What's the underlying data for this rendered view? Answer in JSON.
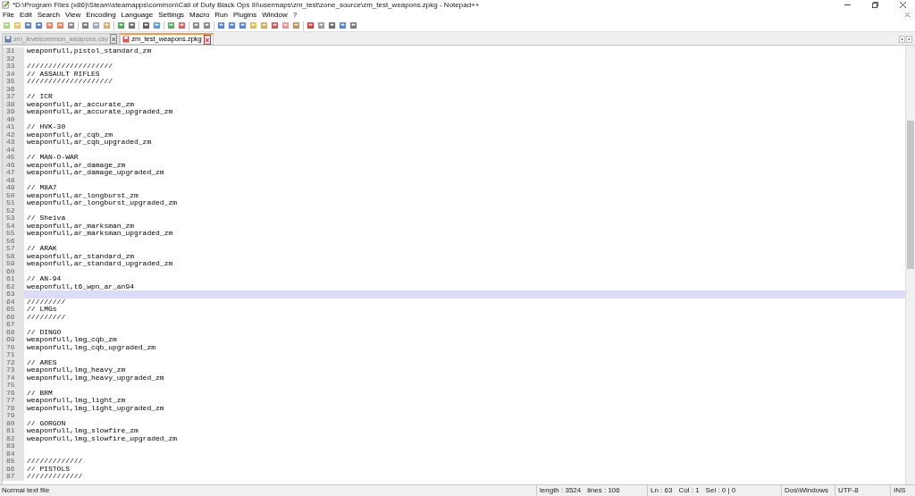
{
  "window": {
    "title": "*D:\\Program Files (x86)\\Steam\\steamapps\\common\\Call of Duty Black Ops III\\usermaps\\zm_test\\zone_source\\zm_test_weapons.zpkg - Notepad++"
  },
  "menu": [
    "File",
    "Edit",
    "Search",
    "View",
    "Encoding",
    "Language",
    "Settings",
    "Macro",
    "Run",
    "Plugins",
    "Window",
    "?"
  ],
  "tabs": [
    {
      "label": "zm_levelcommon_weapons.csv",
      "selected": false,
      "modified": false,
      "close_glyph": "x"
    },
    {
      "label": "zm_test_weapons.zpkg",
      "selected": true,
      "modified": true,
      "close_glyph": "x"
    }
  ],
  "editor": {
    "lines": [
      {
        "number": "31",
        "text": "weaponfull,pistol_standard_zm",
        "selected": false
      },
      {
        "number": "32",
        "selected": false
      },
      {
        "number": "33",
        "text": "////////////////////",
        "selected": false
      },
      {
        "number": "34",
        "text": "// ASSAULT RIFLES",
        "selected": false
      },
      {
        "number": "35",
        "text": "////////////////////",
        "selected": false
      },
      {
        "number": "36",
        "selected": false
      },
      {
        "number": "37",
        "text": "// ICR",
        "selected": false
      },
      {
        "number": "38",
        "text": "weaponfull,ar_accurate_zm",
        "selected": false
      },
      {
        "number": "39",
        "text": "weaponfull,ar_accurate_upgraded_zm",
        "selected": false
      },
      {
        "number": "40",
        "selected": false
      },
      {
        "number": "41",
        "text": "// HVK-30",
        "selected": false
      },
      {
        "number": "42",
        "text": "weaponfull,ar_cqb_zm",
        "selected": false
      },
      {
        "number": "43",
        "text": "weaponfull,ar_cqb_upgraded_zm",
        "selected": false
      },
      {
        "number": "44",
        "selected": false
      },
      {
        "number": "45",
        "text": "// MAN-O-WAR",
        "selected": false
      },
      {
        "number": "46",
        "text": "weaponfull,ar_damage_zm",
        "selected": false
      },
      {
        "number": "47",
        "text": "weaponfull,ar_damage_upgraded_zm",
        "selected": false
      },
      {
        "number": "48",
        "selected": false
      },
      {
        "number": "49",
        "text": "// M8A7",
        "selected": false
      },
      {
        "number": "50",
        "text": "weaponfull,ar_longburst_zm",
        "selected": false
      },
      {
        "number": "51",
        "text": "weaponfull,ar_longburst_upgraded_zm",
        "selected": false
      },
      {
        "number": "52",
        "selected": false
      },
      {
        "number": "53",
        "text": "// Sheiva",
        "selected": false
      },
      {
        "number": "54",
        "text": "weaponfull,ar_marksman_zm",
        "selected": false
      },
      {
        "number": "55",
        "text": "weaponfull,ar_marksman_upgraded_zm",
        "selected": false
      },
      {
        "number": "56",
        "selected": false
      },
      {
        "number": "57",
        "text": "// ARAK",
        "selected": false
      },
      {
        "number": "58",
        "text": "weaponfull,ar_standard_zm",
        "selected": false
      },
      {
        "number": "59",
        "text": "weaponfull,ar_standard_upgraded_zm",
        "selected": false
      },
      {
        "number": "60",
        "selected": false
      },
      {
        "number": "61",
        "text": "// AN-94",
        "selected": false
      },
      {
        "number": "62",
        "text": "weaponfull,t6_wpn_ar_an94",
        "selected": false
      },
      {
        "number": "63",
        "selected": true
      },
      {
        "number": "64",
        "text": "/////////",
        "selected": false
      },
      {
        "number": "65",
        "text": "// LMGs",
        "selected": false
      },
      {
        "number": "66",
        "text": "/////////",
        "selected": false
      },
      {
        "number": "67",
        "selected": false
      },
      {
        "number": "68",
        "text": "// DINGO",
        "selected": false
      },
      {
        "number": "69",
        "text": "weaponfull,lmg_cqb_zm",
        "selected": false
      },
      {
        "number": "70",
        "text": "weaponfull,lmg_cqb_upgraded_zm",
        "selected": false
      },
      {
        "number": "71",
        "selected": false
      },
      {
        "number": "72",
        "text": "// ARES",
        "selected": false
      },
      {
        "number": "73",
        "text": "weaponfull,lmg_heavy_zm",
        "selected": false
      },
      {
        "number": "74",
        "text": "weaponfull,lmg_heavy_upgraded_zm",
        "selected": false
      },
      {
        "number": "75",
        "selected": false
      },
      {
        "number": "76",
        "text": "// BRM",
        "selected": false
      },
      {
        "number": "77",
        "text": "weaponfull,lmg_light_zm",
        "selected": false
      },
      {
        "number": "78",
        "text": "weaponfull,lmg_light_upgraded_zm",
        "selected": false
      },
      {
        "number": "79",
        "selected": false
      },
      {
        "number": "80",
        "text": "// GORGON",
        "selected": false
      },
      {
        "number": "81",
        "text": "weaponfull,lmg_slowfire_zm",
        "selected": false
      },
      {
        "number": "82",
        "text": "weaponfull,lmg_slowfire_upgraded_zm",
        "selected": false
      },
      {
        "number": "83",
        "selected": false
      },
      {
        "number": "84",
        "selected": false
      },
      {
        "number": "85",
        "text": "/////////////",
        "selected": false
      },
      {
        "number": "86",
        "text": "// PISTOLS",
        "selected": false
      },
      {
        "number": "87",
        "text": "/////////////",
        "selected": false
      }
    ]
  },
  "status_bar": {
    "file_type": "Normal text file",
    "length": "length : 3524",
    "lines": "lines : 106",
    "position": "Ln : 63",
    "column": "Col : 1",
    "selection": "Sel : 0 | 0",
    "eol": "Dos\\Windows",
    "encoding": "UTF-8",
    "mode": "INS"
  }
}
